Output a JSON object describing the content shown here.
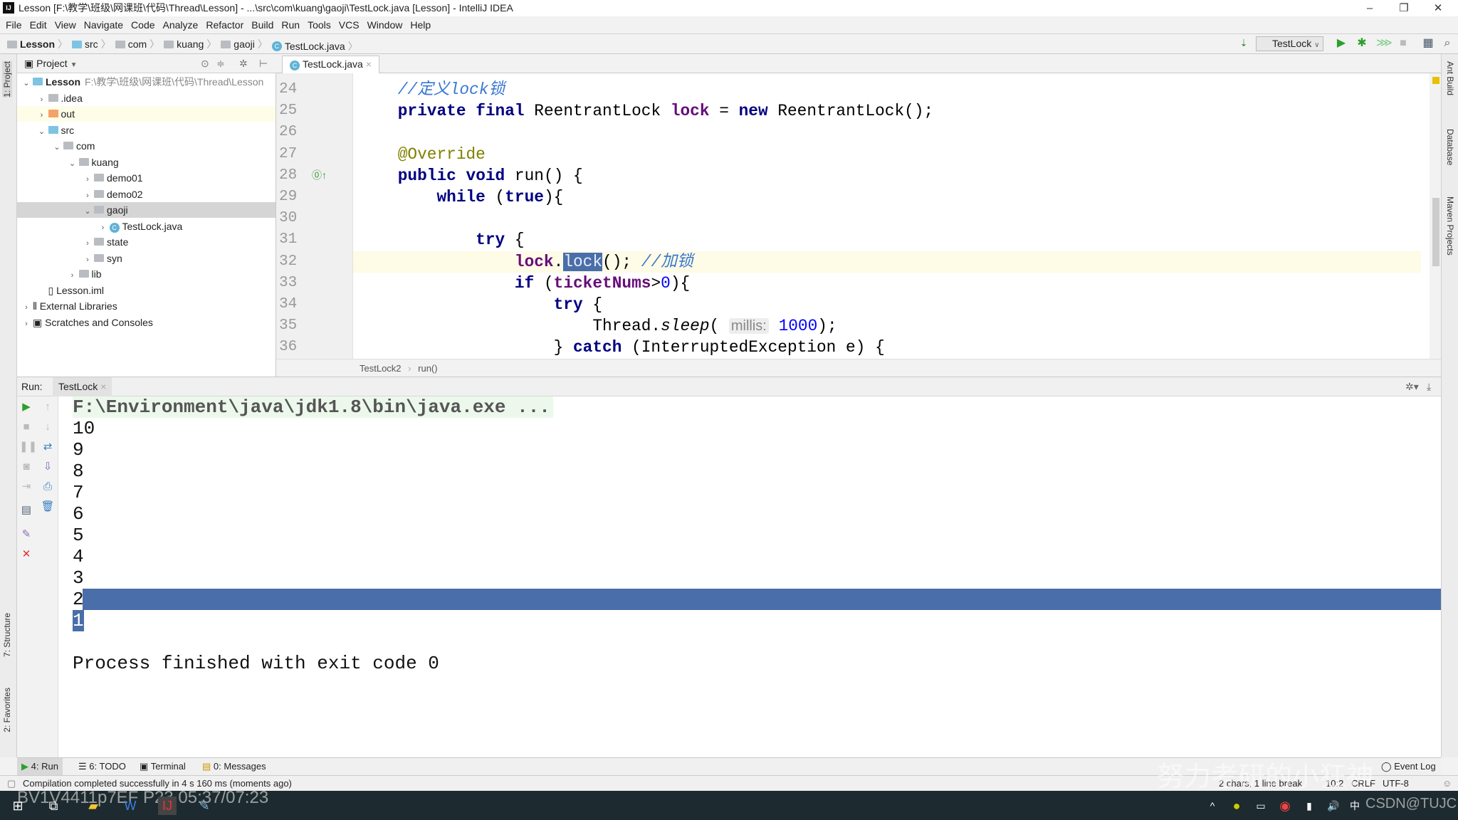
{
  "window": {
    "title": "Lesson [F:\\教学\\班级\\网课班\\代码\\Thread\\Lesson] - ...\\src\\com\\kuang\\gaoji\\TestLock.java [Lesson] - IntelliJ IDEA",
    "logo": "IJ",
    "minimize": "–",
    "maximize": "❐",
    "close": "✕"
  },
  "menu": [
    "File",
    "Edit",
    "View",
    "Navigate",
    "Code",
    "Analyze",
    "Refactor",
    "Build",
    "Run",
    "Tools",
    "VCS",
    "Window",
    "Help"
  ],
  "breadcrumb": [
    {
      "label": "Lesson",
      "icon": "module"
    },
    {
      "label": "src",
      "icon": "folder-blue"
    },
    {
      "label": "com",
      "icon": "folder"
    },
    {
      "label": "kuang",
      "icon": "folder"
    },
    {
      "label": "gaoji",
      "icon": "folder"
    },
    {
      "label": "TestLock.java",
      "icon": "class"
    }
  ],
  "toolbar": {
    "run_config": "TestLock",
    "run": "▶",
    "debug": "✱",
    "coverage": "⋙",
    "stop": "■",
    "structure": "▦",
    "search": "⌕"
  },
  "left_strip": {
    "project": "1: Project",
    "structure": "7: Structure",
    "favorites": "2: Favorites"
  },
  "right_strip": {
    "ant": "Ant Build",
    "database": "Database",
    "maven": "Maven Projects"
  },
  "project_panel": {
    "title": "Project",
    "tree": [
      {
        "label": "Lesson",
        "extra": "F:\\教学\\班级\\网课班\\代码\\Thread\\Lesson",
        "level": 0,
        "arrow": "v",
        "icon": "module",
        "bold": true
      },
      {
        "label": ".idea",
        "level": 1,
        "arrow": ">",
        "icon": "folder"
      },
      {
        "label": "out",
        "level": 1,
        "arrow": ">",
        "icon": "folder-orange",
        "state": "hl"
      },
      {
        "label": "src",
        "level": 1,
        "arrow": "v",
        "icon": "folder-blue"
      },
      {
        "label": "com",
        "level": 2,
        "arrow": "v",
        "icon": "folder"
      },
      {
        "label": "kuang",
        "level": 3,
        "arrow": "v",
        "icon": "folder"
      },
      {
        "label": "demo01",
        "level": 4,
        "arrow": ">",
        "icon": "folder"
      },
      {
        "label": "demo02",
        "level": 4,
        "arrow": ">",
        "icon": "folder"
      },
      {
        "label": "gaoji",
        "level": 4,
        "arrow": "v",
        "icon": "folder",
        "state": "sel"
      },
      {
        "label": "TestLock.java",
        "level": 5,
        "arrow": ">",
        "icon": "class"
      },
      {
        "label": "state",
        "level": 4,
        "arrow": ">",
        "icon": "folder"
      },
      {
        "label": "syn",
        "level": 4,
        "arrow": ">",
        "icon": "folder"
      },
      {
        "label": "lib",
        "level": 3,
        "arrow": ">",
        "icon": "folder"
      },
      {
        "label": "Lesson.iml",
        "level": 1,
        "arrow": "",
        "icon": "file"
      },
      {
        "label": "External Libraries",
        "level": 0,
        "arrow": ">",
        "icon": "library"
      },
      {
        "label": "Scratches and Consoles",
        "level": 0,
        "arrow": ">",
        "icon": "scratch"
      }
    ]
  },
  "editor": {
    "tab": "TestLock.java",
    "tab_close": "×",
    "current_line": 32,
    "lines": [
      {
        "n": "24",
        "t": [
          [
            "",
            "    "
          ],
          [
            "cm",
            "//定义lock锁"
          ]
        ]
      },
      {
        "n": "25",
        "t": [
          [
            "",
            "    "
          ],
          [
            "kw",
            "private"
          ],
          [
            "",
            " "
          ],
          [
            "kw",
            "final"
          ],
          [
            "",
            " ReentrantLock "
          ],
          [
            "fd",
            "lock"
          ],
          [
            "",
            " = "
          ],
          [
            "kw",
            "new"
          ],
          [
            "",
            " ReentrantLock();"
          ]
        ]
      },
      {
        "n": "26",
        "t": []
      },
      {
        "n": "27",
        "t": [
          [
            "",
            "    "
          ],
          [
            "an",
            "@Override"
          ]
        ]
      },
      {
        "n": "28",
        "t": [
          [
            "",
            "    "
          ],
          [
            "kw",
            "public"
          ],
          [
            "",
            " "
          ],
          [
            "kw",
            "void"
          ],
          [
            "",
            " run() {"
          ]
        ]
      },
      {
        "n": "29",
        "t": [
          [
            "",
            "        "
          ],
          [
            "kw",
            "while"
          ],
          [
            "",
            " ("
          ],
          [
            "kw",
            "true"
          ],
          [
            "",
            "){"
          ]
        ]
      },
      {
        "n": "30",
        "t": []
      },
      {
        "n": "31",
        "t": [
          [
            "",
            "            "
          ],
          [
            "kw",
            "try"
          ],
          [
            "",
            " {"
          ]
        ]
      },
      {
        "n": "32",
        "t": [
          [
            "",
            "                "
          ],
          [
            "fd",
            "lock"
          ],
          [
            "",
            "."
          ],
          [
            "selw",
            "lock"
          ],
          [
            "",
            "(); "
          ],
          [
            "cm",
            "//加锁"
          ]
        ]
      },
      {
        "n": "33",
        "t": [
          [
            "",
            "                "
          ],
          [
            "kw",
            "if"
          ],
          [
            "",
            " ("
          ],
          [
            "fd",
            "ticketNums"
          ],
          [
            "",
            ">"
          ],
          [
            "nm",
            "0"
          ],
          [
            "",
            "){"
          ]
        ]
      },
      {
        "n": "34",
        "t": [
          [
            "",
            "                    "
          ],
          [
            "kw",
            "try"
          ],
          [
            "",
            " {"
          ]
        ]
      },
      {
        "n": "35",
        "t": [
          [
            "",
            "                        Thread."
          ],
          [
            "it",
            "sleep"
          ],
          [
            "",
            "( "
          ],
          [
            "hint",
            "millis:"
          ],
          [
            "",
            " "
          ],
          [
            "nm",
            "1000"
          ],
          [
            "",
            ");"
          ]
        ]
      },
      {
        "n": "36",
        "t": [
          [
            "",
            "                    } "
          ],
          [
            "kw",
            "catch"
          ],
          [
            "",
            " (InterruptedException e) {"
          ]
        ]
      }
    ],
    "crumb": [
      "TestLock2",
      "run()"
    ]
  },
  "run_panel": {
    "label": "Run:",
    "tab": "TestLock",
    "tab_close": "×",
    "command": "F:\\Environment\\java\\jdk1.8\\bin\\java.exe ...",
    "output": [
      "10",
      "9",
      "8",
      "7",
      "6",
      "5",
      "4",
      "3",
      "2",
      "1"
    ],
    "selected_line": "2",
    "finish": "Process finished with exit code 0"
  },
  "bottom_tabs": [
    "4: Run",
    "6: TODO",
    "Terminal",
    "0: Messages"
  ],
  "event_log": "Event Log",
  "status": {
    "message": "Compilation completed successfully in 4 s 160 ms (moments ago)",
    "selection": "2 chars, 1 line break",
    "position": "10:2",
    "line_sep": "CRLF",
    "encoding": "UTF-8"
  },
  "overlay": {
    "video": "BV1V4411p7EF P23 05:37/07:23",
    "watermark": "努力考研的小狂神",
    "csdn": "CSDN@TUJC"
  },
  "taskbar": {
    "ime": "中",
    "tray_up": "^"
  }
}
